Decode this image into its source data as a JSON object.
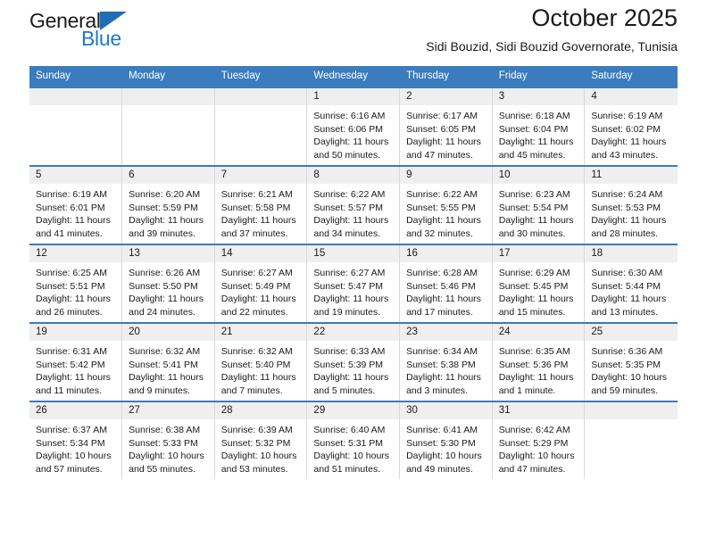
{
  "brand": {
    "name_part1": "General",
    "name_part2": "Blue",
    "triangle_color": "#1f6db5",
    "blue_color": "#2079c6"
  },
  "header": {
    "title": "October 2025",
    "subtitle": "Sidi Bouzid, Sidi Bouzid Governorate, Tunisia"
  },
  "theme": {
    "header_band": "#3a7cbe",
    "daynum_band": "#efefef",
    "text": "#1a1a1a"
  },
  "calendar": {
    "weekdays": [
      "Sunday",
      "Monday",
      "Tuesday",
      "Wednesday",
      "Thursday",
      "Friday",
      "Saturday"
    ],
    "weeks": [
      [
        {
          "day": "",
          "sunrise": "",
          "sunset": "",
          "daylight": "",
          "empty": true
        },
        {
          "day": "",
          "sunrise": "",
          "sunset": "",
          "daylight": "",
          "empty": true
        },
        {
          "day": "",
          "sunrise": "",
          "sunset": "",
          "daylight": "",
          "empty": true
        },
        {
          "day": "1",
          "sunrise": "Sunrise: 6:16 AM",
          "sunset": "Sunset: 6:06 PM",
          "daylight": "Daylight: 11 hours and 50 minutes."
        },
        {
          "day": "2",
          "sunrise": "Sunrise: 6:17 AM",
          "sunset": "Sunset: 6:05 PM",
          "daylight": "Daylight: 11 hours and 47 minutes."
        },
        {
          "day": "3",
          "sunrise": "Sunrise: 6:18 AM",
          "sunset": "Sunset: 6:04 PM",
          "daylight": "Daylight: 11 hours and 45 minutes."
        },
        {
          "day": "4",
          "sunrise": "Sunrise: 6:19 AM",
          "sunset": "Sunset: 6:02 PM",
          "daylight": "Daylight: 11 hours and 43 minutes."
        }
      ],
      [
        {
          "day": "5",
          "sunrise": "Sunrise: 6:19 AM",
          "sunset": "Sunset: 6:01 PM",
          "daylight": "Daylight: 11 hours and 41 minutes."
        },
        {
          "day": "6",
          "sunrise": "Sunrise: 6:20 AM",
          "sunset": "Sunset: 5:59 PM",
          "daylight": "Daylight: 11 hours and 39 minutes."
        },
        {
          "day": "7",
          "sunrise": "Sunrise: 6:21 AM",
          "sunset": "Sunset: 5:58 PM",
          "daylight": "Daylight: 11 hours and 37 minutes."
        },
        {
          "day": "8",
          "sunrise": "Sunrise: 6:22 AM",
          "sunset": "Sunset: 5:57 PM",
          "daylight": "Daylight: 11 hours and 34 minutes."
        },
        {
          "day": "9",
          "sunrise": "Sunrise: 6:22 AM",
          "sunset": "Sunset: 5:55 PM",
          "daylight": "Daylight: 11 hours and 32 minutes."
        },
        {
          "day": "10",
          "sunrise": "Sunrise: 6:23 AM",
          "sunset": "Sunset: 5:54 PM",
          "daylight": "Daylight: 11 hours and 30 minutes."
        },
        {
          "day": "11",
          "sunrise": "Sunrise: 6:24 AM",
          "sunset": "Sunset: 5:53 PM",
          "daylight": "Daylight: 11 hours and 28 minutes."
        }
      ],
      [
        {
          "day": "12",
          "sunrise": "Sunrise: 6:25 AM",
          "sunset": "Sunset: 5:51 PM",
          "daylight": "Daylight: 11 hours and 26 minutes."
        },
        {
          "day": "13",
          "sunrise": "Sunrise: 6:26 AM",
          "sunset": "Sunset: 5:50 PM",
          "daylight": "Daylight: 11 hours and 24 minutes."
        },
        {
          "day": "14",
          "sunrise": "Sunrise: 6:27 AM",
          "sunset": "Sunset: 5:49 PM",
          "daylight": "Daylight: 11 hours and 22 minutes."
        },
        {
          "day": "15",
          "sunrise": "Sunrise: 6:27 AM",
          "sunset": "Sunset: 5:47 PM",
          "daylight": "Daylight: 11 hours and 19 minutes."
        },
        {
          "day": "16",
          "sunrise": "Sunrise: 6:28 AM",
          "sunset": "Sunset: 5:46 PM",
          "daylight": "Daylight: 11 hours and 17 minutes."
        },
        {
          "day": "17",
          "sunrise": "Sunrise: 6:29 AM",
          "sunset": "Sunset: 5:45 PM",
          "daylight": "Daylight: 11 hours and 15 minutes."
        },
        {
          "day": "18",
          "sunrise": "Sunrise: 6:30 AM",
          "sunset": "Sunset: 5:44 PM",
          "daylight": "Daylight: 11 hours and 13 minutes."
        }
      ],
      [
        {
          "day": "19",
          "sunrise": "Sunrise: 6:31 AM",
          "sunset": "Sunset: 5:42 PM",
          "daylight": "Daylight: 11 hours and 11 minutes."
        },
        {
          "day": "20",
          "sunrise": "Sunrise: 6:32 AM",
          "sunset": "Sunset: 5:41 PM",
          "daylight": "Daylight: 11 hours and 9 minutes."
        },
        {
          "day": "21",
          "sunrise": "Sunrise: 6:32 AM",
          "sunset": "Sunset: 5:40 PM",
          "daylight": "Daylight: 11 hours and 7 minutes."
        },
        {
          "day": "22",
          "sunrise": "Sunrise: 6:33 AM",
          "sunset": "Sunset: 5:39 PM",
          "daylight": "Daylight: 11 hours and 5 minutes."
        },
        {
          "day": "23",
          "sunrise": "Sunrise: 6:34 AM",
          "sunset": "Sunset: 5:38 PM",
          "daylight": "Daylight: 11 hours and 3 minutes."
        },
        {
          "day": "24",
          "sunrise": "Sunrise: 6:35 AM",
          "sunset": "Sunset: 5:36 PM",
          "daylight": "Daylight: 11 hours and 1 minute."
        },
        {
          "day": "25",
          "sunrise": "Sunrise: 6:36 AM",
          "sunset": "Sunset: 5:35 PM",
          "daylight": "Daylight: 10 hours and 59 minutes."
        }
      ],
      [
        {
          "day": "26",
          "sunrise": "Sunrise: 6:37 AM",
          "sunset": "Sunset: 5:34 PM",
          "daylight": "Daylight: 10 hours and 57 minutes."
        },
        {
          "day": "27",
          "sunrise": "Sunrise: 6:38 AM",
          "sunset": "Sunset: 5:33 PM",
          "daylight": "Daylight: 10 hours and 55 minutes."
        },
        {
          "day": "28",
          "sunrise": "Sunrise: 6:39 AM",
          "sunset": "Sunset: 5:32 PM",
          "daylight": "Daylight: 10 hours and 53 minutes."
        },
        {
          "day": "29",
          "sunrise": "Sunrise: 6:40 AM",
          "sunset": "Sunset: 5:31 PM",
          "daylight": "Daylight: 10 hours and 51 minutes."
        },
        {
          "day": "30",
          "sunrise": "Sunrise: 6:41 AM",
          "sunset": "Sunset: 5:30 PM",
          "daylight": "Daylight: 10 hours and 49 minutes."
        },
        {
          "day": "31",
          "sunrise": "Sunrise: 6:42 AM",
          "sunset": "Sunset: 5:29 PM",
          "daylight": "Daylight: 10 hours and 47 minutes."
        },
        {
          "day": "",
          "sunrise": "",
          "sunset": "",
          "daylight": "",
          "empty": true
        }
      ]
    ]
  }
}
